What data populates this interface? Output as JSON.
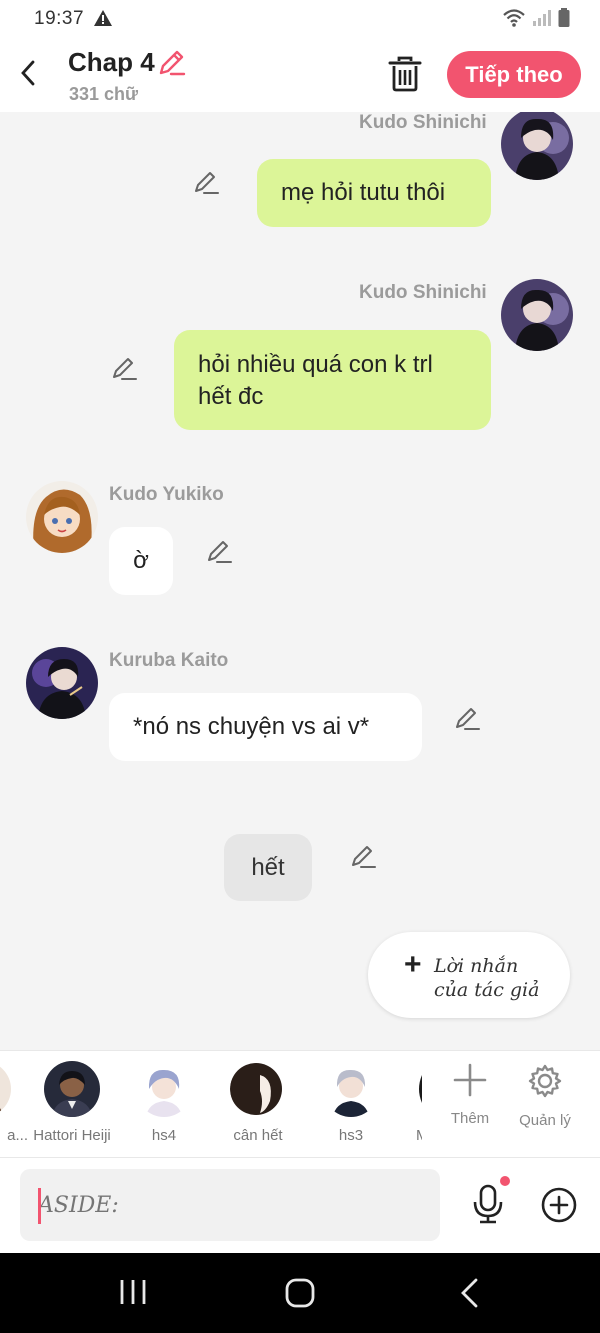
{
  "status": {
    "time": "19:37"
  },
  "header": {
    "title": "Chap 4",
    "word_count": "331 chữ",
    "next_label": "Tiếp theo"
  },
  "messages": [
    {
      "speaker": "Kudo Shinichi",
      "text": "mẹ hỏi tutu thôi",
      "side": "right"
    },
    {
      "speaker": "Kudo Shinichi",
      "text": "hỏi nhiều quá con k trl hết đc",
      "side": "right"
    },
    {
      "speaker": "Kudo Yukiko",
      "text": "ờ",
      "side": "left"
    },
    {
      "speaker": "Kuruba Kaito",
      "text": "*nó ns chuyện vs ai v*",
      "side": "left"
    },
    {
      "speaker": "",
      "text": "hết",
      "side": "center"
    }
  ],
  "author_note": {
    "line1": "Lời nhắn",
    "line2": "của tác giả"
  },
  "characters": [
    {
      "name": "a..."
    },
    {
      "name": "Hattori Heiji"
    },
    {
      "name": "hs4"
    },
    {
      "name": "cân hết"
    },
    {
      "name": "hs3"
    },
    {
      "name": "M"
    }
  ],
  "tools": {
    "add_label": "Thêm",
    "manage_label": "Quản lý"
  },
  "input": {
    "placeholder": "ASIDE:"
  },
  "colors": {
    "accent": "#f2546f",
    "bubble_green": "#dcf598",
    "bubble_white": "#ffffff"
  }
}
